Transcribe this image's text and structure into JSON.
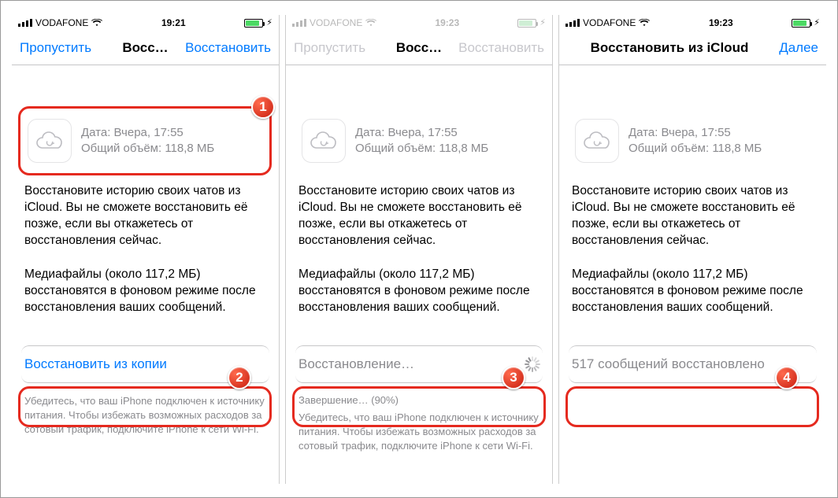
{
  "screens": [
    {
      "status": {
        "carrier": "VODAFONE",
        "time": "19:21",
        "dim": false
      },
      "nav": {
        "left": "Пропустить",
        "title": "Восс…",
        "right": "Восстановить",
        "dim": false,
        "wideTitle": false
      },
      "backup": {
        "date_label": "Дата: Вчера, 17:55",
        "size_label": "Общий объём: 118,8 МБ"
      },
      "desc1": "Восстановите историю своих чатов из iCloud. Вы не сможете восстановить её позже, если вы откажетесь от восстановления сейчас.",
      "desc2": "Медиафайлы (около 117,2 МБ) восстановятся в фоновом режиме после восстановления ваших сообщений.",
      "action": {
        "label": "Восстановить из копии",
        "style": "blue",
        "spinner": false
      },
      "progress": null,
      "note": "Убедитесь, что ваш iPhone подключен к источнику питания. Чтобы избежать возможных расходов за сотовый трафик, подключите iPhone к сети Wi-Fi.",
      "hl_card": true,
      "badge_card": "1",
      "badge_action": "2"
    },
    {
      "status": {
        "carrier": "VODAFONE",
        "time": "19:23",
        "dim": true
      },
      "nav": {
        "left": "Пропустить",
        "title": "Восс…",
        "right": "Восстановить",
        "dim": true,
        "wideTitle": false
      },
      "backup": {
        "date_label": "Дата: Вчера, 17:55",
        "size_label": "Общий объём: 118,8 МБ"
      },
      "desc1": "Восстановите историю своих чатов из iCloud. Вы не сможете восстановить её позже, если вы откажетесь от восстановления сейчас.",
      "desc2": "Медиафайлы (около 117,2 МБ) восстановятся в фоновом режиме после восстановления ваших сообщений.",
      "action": {
        "label": "Восстановление…",
        "style": "gray",
        "spinner": true
      },
      "progress": "Завершение… (90%)",
      "note": "Убедитесь, что ваш iPhone подключен к источнику питания. Чтобы избежать возможных расходов за сотовый трафик, подключите iPhone к сети Wi-Fi.",
      "hl_card": false,
      "badge_card": null,
      "badge_action": "3"
    },
    {
      "status": {
        "carrier": "VODAFONE",
        "time": "19:23",
        "dim": false
      },
      "nav": {
        "left": "",
        "title": "Восстановить из iCloud",
        "right": "Далее",
        "dim": false,
        "wideTitle": true
      },
      "backup": {
        "date_label": "Дата: Вчера, 17:55",
        "size_label": "Общий объём: 118,8 МБ"
      },
      "desc1": "Восстановите историю своих чатов из iCloud. Вы не сможете восстановить её позже, если вы откажетесь от восстановления сейчас.",
      "desc2": "Медиафайлы (около 117,2 МБ) восстановятся в фоновом режиме после восстановления ваших сообщений.",
      "action": {
        "label": "517 сообщений восстановлено",
        "style": "gray",
        "spinner": false
      },
      "progress": null,
      "note": null,
      "hl_card": false,
      "badge_card": null,
      "badge_action": "4"
    }
  ]
}
